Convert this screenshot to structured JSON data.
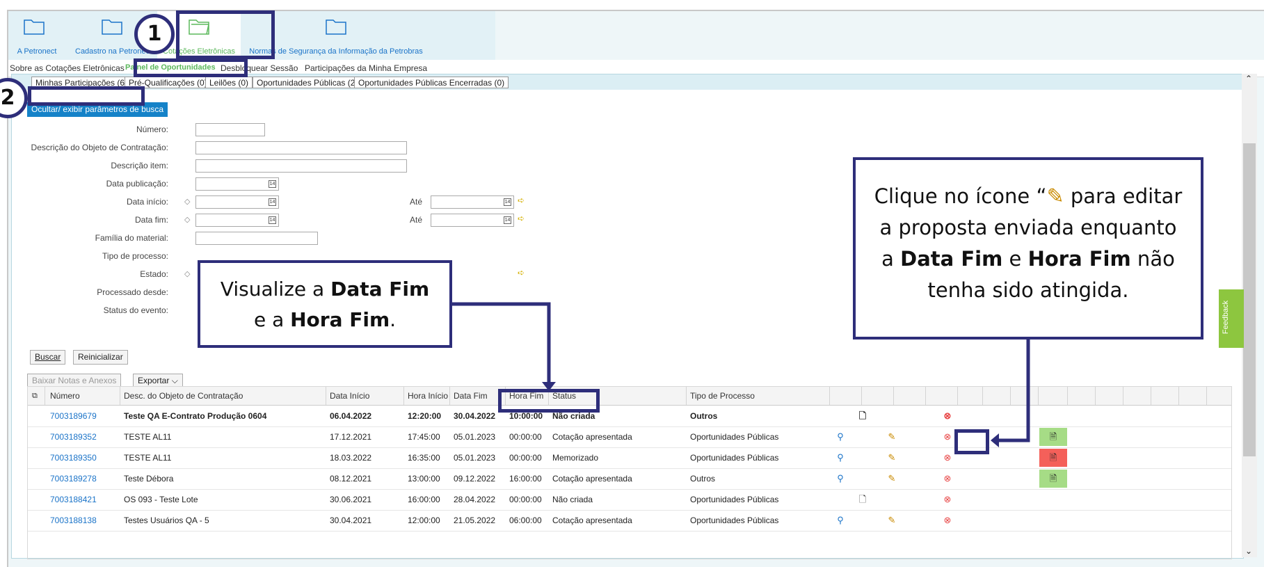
{
  "nav": {
    "items": [
      {
        "label": "A Petronect"
      },
      {
        "label": "Cadastro na Petronect"
      },
      {
        "label": "Cotações Eletrônicas"
      },
      {
        "label": "Normas de Segurança da Informação da Petrobras"
      }
    ]
  },
  "subnav": {
    "items": [
      {
        "label": "Sobre as Cotações Eletrônicas"
      },
      {
        "label": "Painel de Oportunidades"
      },
      {
        "label": "Desbloquear Sessão"
      },
      {
        "label": "Participações da Minha Empresa"
      }
    ]
  },
  "tabs": [
    {
      "label": "Minhas Participações (6)"
    },
    {
      "label": "Pré-Qualificações (0)"
    },
    {
      "label": "Leilões (0)"
    },
    {
      "label": "Oportunidades Públicas (2)"
    },
    {
      "label": "Oportunidades Públicas Encerradas (0)"
    }
  ],
  "search": {
    "toggle_label": "Ocultar/ exibir parâmetros de busca",
    "fields": {
      "numero": "Número:",
      "descricao_objeto": "Descrição do Objeto de Contratação:",
      "descricao_item": "Descrição item:",
      "data_publicacao": "Data publicação:",
      "data_inicio": "Data início:",
      "data_fim": "Data fim:",
      "familia": "Família do material:",
      "tipo_processo": "Tipo de processo:",
      "estado": "Estado:",
      "processado_desde": "Processado desde:",
      "status_evento": "Status do evento:",
      "ate": "Até"
    },
    "buscar": "Buscar",
    "reinicializar": "Reinicializar"
  },
  "toolbar": {
    "baixar": "Baixar Notas e Anexos",
    "exportar": "Exportar"
  },
  "table": {
    "headers": [
      "Número",
      "Desc. do Objeto de Contratação",
      "Data Início",
      "Hora Início",
      "Data Fim",
      "Hora Fim",
      "Status",
      "Tipo de Processo"
    ],
    "rows": [
      {
        "numero": "7003189679",
        "desc": "Teste QA E-Contrato Produção 0604",
        "data_inicio": "06.04.2022",
        "hora_inicio": "12:20:00",
        "data_fim": "30.04.2022",
        "hora_fim": "10:00:00",
        "status": "Não criada",
        "tipo": "Outros",
        "bold": true
      },
      {
        "numero": "7003189352",
        "desc": "TESTE AL11",
        "data_inicio": "17.12.2021",
        "hora_inicio": "17:45:00",
        "data_fim": "05.01.2023",
        "hora_fim": "00:00:00",
        "status": "Cotação apresentada",
        "tipo": "Oportunidades Públicas"
      },
      {
        "numero": "7003189350",
        "desc": "TESTE AL11",
        "data_inicio": "18.03.2022",
        "hora_inicio": "16:35:00",
        "data_fim": "05.01.2023",
        "hora_fim": "00:00:00",
        "status": "Memorizado",
        "tipo": "Oportunidades Públicas"
      },
      {
        "numero": "7003189278",
        "desc": "Teste Débora",
        "data_inicio": "08.12.2021",
        "hora_inicio": "13:00:00",
        "data_fim": "09.12.2022",
        "hora_fim": "16:00:00",
        "status": "Cotação apresentada",
        "tipo": "Outros"
      },
      {
        "numero": "7003188421",
        "desc": "OS 093 - Teste Lote",
        "data_inicio": "30.06.2021",
        "hora_inicio": "16:00:00",
        "data_fim": "28.04.2022",
        "hora_fim": "00:00:00",
        "status": "Não criada",
        "tipo": "Oportunidades Públicas"
      },
      {
        "numero": "7003188138",
        "desc": "Testes Usuários QA - 5",
        "data_inicio": "30.04.2021",
        "hora_inicio": "12:00:00",
        "data_fim": "21.05.2022",
        "hora_fim": "06:00:00",
        "status": "Cotação apresentada",
        "tipo": "Oportunidades Públicas"
      }
    ]
  },
  "feedback": "Feedback",
  "callouts": {
    "badge1": "1",
    "badge2": "2",
    "left_line1_a": "Visualize a ",
    "left_line1_b": "Data Fim",
    "left_line2_a": "e a ",
    "left_line2_b": "Hora Fim",
    "left_line2_c": ".",
    "right_a": "Clique no ícone “",
    "right_b": " para editar a proposta enviada enquanto a ",
    "right_c": "Data Fim",
    "right_d": " e ",
    "right_e": "Hora Fim",
    "right_f": " não tenha sido atingida."
  },
  "colors": {
    "accent_blue": "#1582c8",
    "callout_border": "#2e2e7a",
    "active_green": "#5cb85c",
    "feedback_green": "#8dc63f",
    "danger_red": "#e84545"
  }
}
